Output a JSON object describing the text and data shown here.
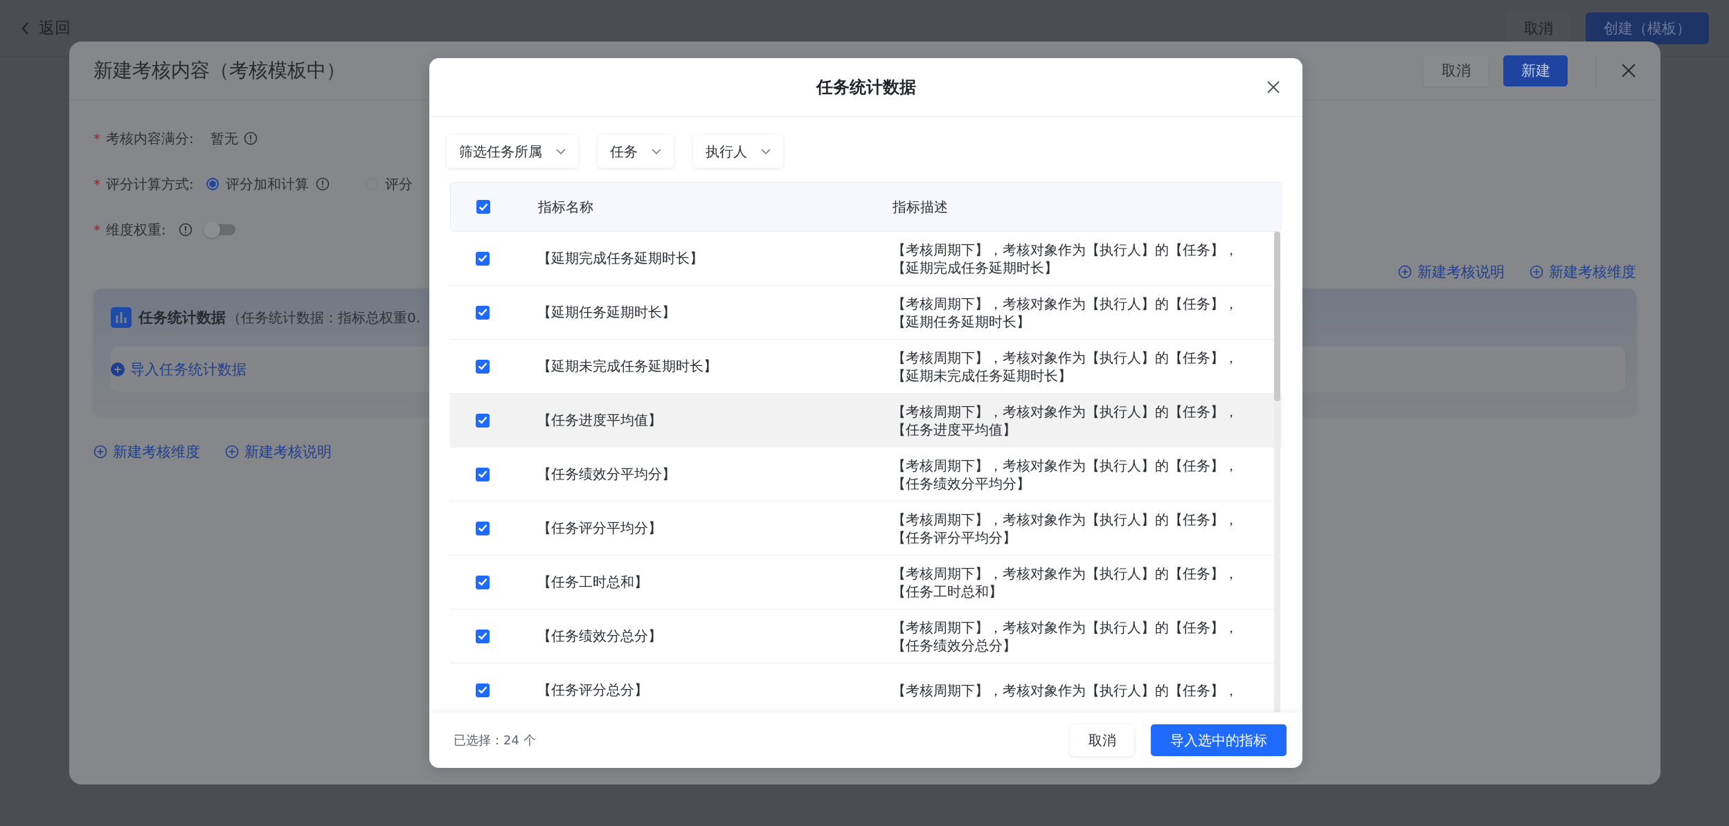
{
  "page": {
    "back_link": "返回",
    "cancel_button": "取消",
    "create_button": "创建（模板）"
  },
  "editor": {
    "title": "新建考核内容（考核模板中）",
    "cancel_button": "取消",
    "create_button": "新建",
    "fields": [
      {
        "kind": "value",
        "marker": "*",
        "label": "考核内容满分:",
        "value": "暂无"
      },
      {
        "kind": "radio",
        "marker": "*",
        "label": "评分计算方式:",
        "options": [
          {
            "label": "评分加和计算",
            "selected": true
          },
          {
            "label": "评分",
            "selected": false
          }
        ]
      },
      {
        "kind": "switch",
        "marker": "*",
        "label": "维度权重:",
        "on": false
      }
    ],
    "top_links": [
      "新建考核说明",
      "新建考核维度"
    ],
    "section": {
      "title": "任务统计数据",
      "subtitle": "（任务统计数据：指标总权重0.",
      "import_link": "导入任务统计数据"
    },
    "bottom_links": [
      "新建考核维度",
      "新建考核说明"
    ]
  },
  "dialog": {
    "title": "任务统计数据",
    "filters": [
      "筛选任务所属",
      "任务",
      "执行人"
    ],
    "table": {
      "all_checked": true,
      "columns": [
        "指标名称",
        "指标描述"
      ],
      "rows": [
        {
          "checked": true,
          "highlighted": false,
          "name": "【延期完成任务延期时长】",
          "description": [
            "【考核周期下】，考核对象作为【执行人】的【任务】，",
            "【延期完成任务延期时长】"
          ]
        },
        {
          "checked": true,
          "highlighted": false,
          "name": "【延期任务延期时长】",
          "description": [
            "【考核周期下】，考核对象作为【执行人】的【任务】，",
            "【延期任务延期时长】"
          ]
        },
        {
          "checked": true,
          "highlighted": false,
          "name": "【延期未完成任务延期时长】",
          "description": [
            "【考核周期下】，考核对象作为【执行人】的【任务】，",
            "【延期未完成任务延期时长】"
          ]
        },
        {
          "checked": true,
          "highlighted": true,
          "name": "【任务进度平均值】",
          "description": [
            "【考核周期下】，考核对象作为【执行人】的【任务】，",
            "【任务进度平均值】"
          ]
        },
        {
          "checked": true,
          "highlighted": false,
          "name": "【任务绩效分平均分】",
          "description": [
            "【考核周期下】，考核对象作为【执行人】的【任务】，",
            "【任务绩效分平均分】"
          ]
        },
        {
          "checked": true,
          "highlighted": false,
          "name": "【任务评分平均分】",
          "description": [
            "【考核周期下】，考核对象作为【执行人】的【任务】，",
            "【任务评分平均分】"
          ]
        },
        {
          "checked": true,
          "highlighted": false,
          "name": "【任务工时总和】",
          "description": [
            "【考核周期下】，考核对象作为【执行人】的【任务】，",
            "【任务工时总和】"
          ]
        },
        {
          "checked": true,
          "highlighted": false,
          "name": "【任务绩效分总分】",
          "description": [
            "【考核周期下】，考核对象作为【执行人】的【任务】，",
            "【任务绩效分总分】"
          ]
        },
        {
          "checked": true,
          "highlighted": false,
          "name": "【任务评分总分】",
          "description": [
            "【考核周期下】，考核对象作为【执行人】的【任务】，"
          ]
        }
      ]
    },
    "selected_count": "已选择：24 个",
    "cancel_button": "取消",
    "import_button": "导入选中的指标"
  }
}
